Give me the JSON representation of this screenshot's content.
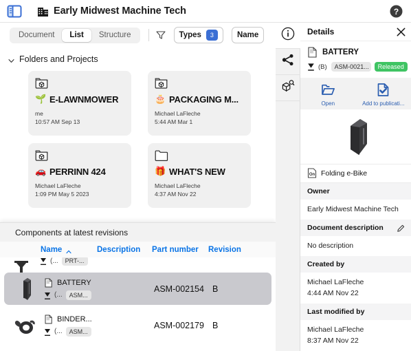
{
  "topbar": {
    "panel_toggle_icon": "sidebar-toggle-icon",
    "org_icon": "building-icon",
    "title": "Early Midwest Machine Tech",
    "help_icon": "help-circle-icon"
  },
  "toolbar": {
    "segments": [
      {
        "label": "Document",
        "active": false
      },
      {
        "label": "List",
        "active": true
      },
      {
        "label": "Structure",
        "active": false
      }
    ],
    "filter_icon": "funnel-icon",
    "types_button": {
      "label": "Types",
      "count": "3"
    },
    "name_button": {
      "label": "Name"
    }
  },
  "browser": {
    "section_title": "Folders and Projects",
    "chevron_icon": "chevron-down-icon",
    "cards": [
      {
        "icon": "folder-3d-icon",
        "emoji": "🌱",
        "name": "E-LAWNMOWER",
        "owner": "me",
        "timestamp": "10:57 AM Sep 13"
      },
      {
        "icon": "folder-3d-icon",
        "emoji": "🎂",
        "name": "PACKAGING M...",
        "owner": "Michael LaFleche",
        "timestamp": "5:44 AM Mar 1"
      },
      {
        "icon": "folder-3d-icon",
        "emoji": "🚗",
        "name": "PERRINN 424",
        "owner": "Michael LaFleche",
        "timestamp": "1:09 PM May 5 2023"
      },
      {
        "icon": "folder-plain-icon",
        "emoji": "🎁",
        "name": "WHAT'S NEW",
        "owner": "Michael LaFleche",
        "timestamp": "4:37 AM Nov 22"
      }
    ]
  },
  "components_panel": {
    "title": "Components at latest revisions",
    "columns": [
      {
        "label": "Name",
        "sorted": "asc"
      },
      {
        "label": "Description",
        "sorted": ""
      },
      {
        "label": "Part number",
        "sorted": ""
      },
      {
        "label": "Revision",
        "sorted": ""
      }
    ],
    "clipped_row": {
      "chip": "PRT-..."
    },
    "rows": [
      {
        "thumb": "battery-thumbnail",
        "doc_icon": "document-icon",
        "name": "BATTERY",
        "rev_icon": "revision-icon",
        "paren": "(...",
        "chip": "ASM...",
        "part_number": "ASM-002154",
        "revision": "B",
        "selected": true
      },
      {
        "thumb": "binder-clamp-thumbnail",
        "doc_icon": "document-icon",
        "name": "BINDER...",
        "rev_icon": "revision-icon",
        "paren": "(...",
        "chip": "ASM...",
        "part_number": "ASM-002179",
        "revision": "B",
        "selected": false
      }
    ]
  },
  "rail": {
    "items": [
      {
        "icon": "info-icon",
        "active": true
      },
      {
        "icon": "share-icon",
        "active": false
      },
      {
        "icon": "cube-search-icon",
        "active": false
      }
    ]
  },
  "details": {
    "header": "Details",
    "close_icon": "close-icon",
    "doc_icon": "document-icon",
    "name": "BATTERY",
    "rev_icon": "revision-icon",
    "revision": "(B)",
    "part_chip": "ASM-0021...",
    "status": "Released",
    "actions": [
      {
        "icon": "open-folder-icon",
        "label": "Open"
      },
      {
        "icon": "add-to-publication-icon",
        "label": "Add to publicati..."
      }
    ],
    "preview_alt": "battery-preview",
    "file_icon": "onshape-doc-icon",
    "file_name": "Folding e-Bike",
    "fields": [
      {
        "label": "Owner",
        "editable": false,
        "value": "Early Midwest Machine Tech",
        "value2": ""
      },
      {
        "label": "Document description",
        "editable": true,
        "value": "No description",
        "value2": ""
      },
      {
        "label": "Created by",
        "editable": false,
        "value": "Michael LaFleche",
        "value2": "4:44 AM Nov 22"
      },
      {
        "label": "Last modified by",
        "editable": false,
        "value": "Michael LaFleche",
        "value2": "8:37 AM Nov 22"
      }
    ]
  },
  "colors": {
    "accent_blue": "#0a74e6",
    "badge_blue": "#3b6fd4",
    "status_green": "#3fc463",
    "selected_row": "#c9c9ce"
  }
}
